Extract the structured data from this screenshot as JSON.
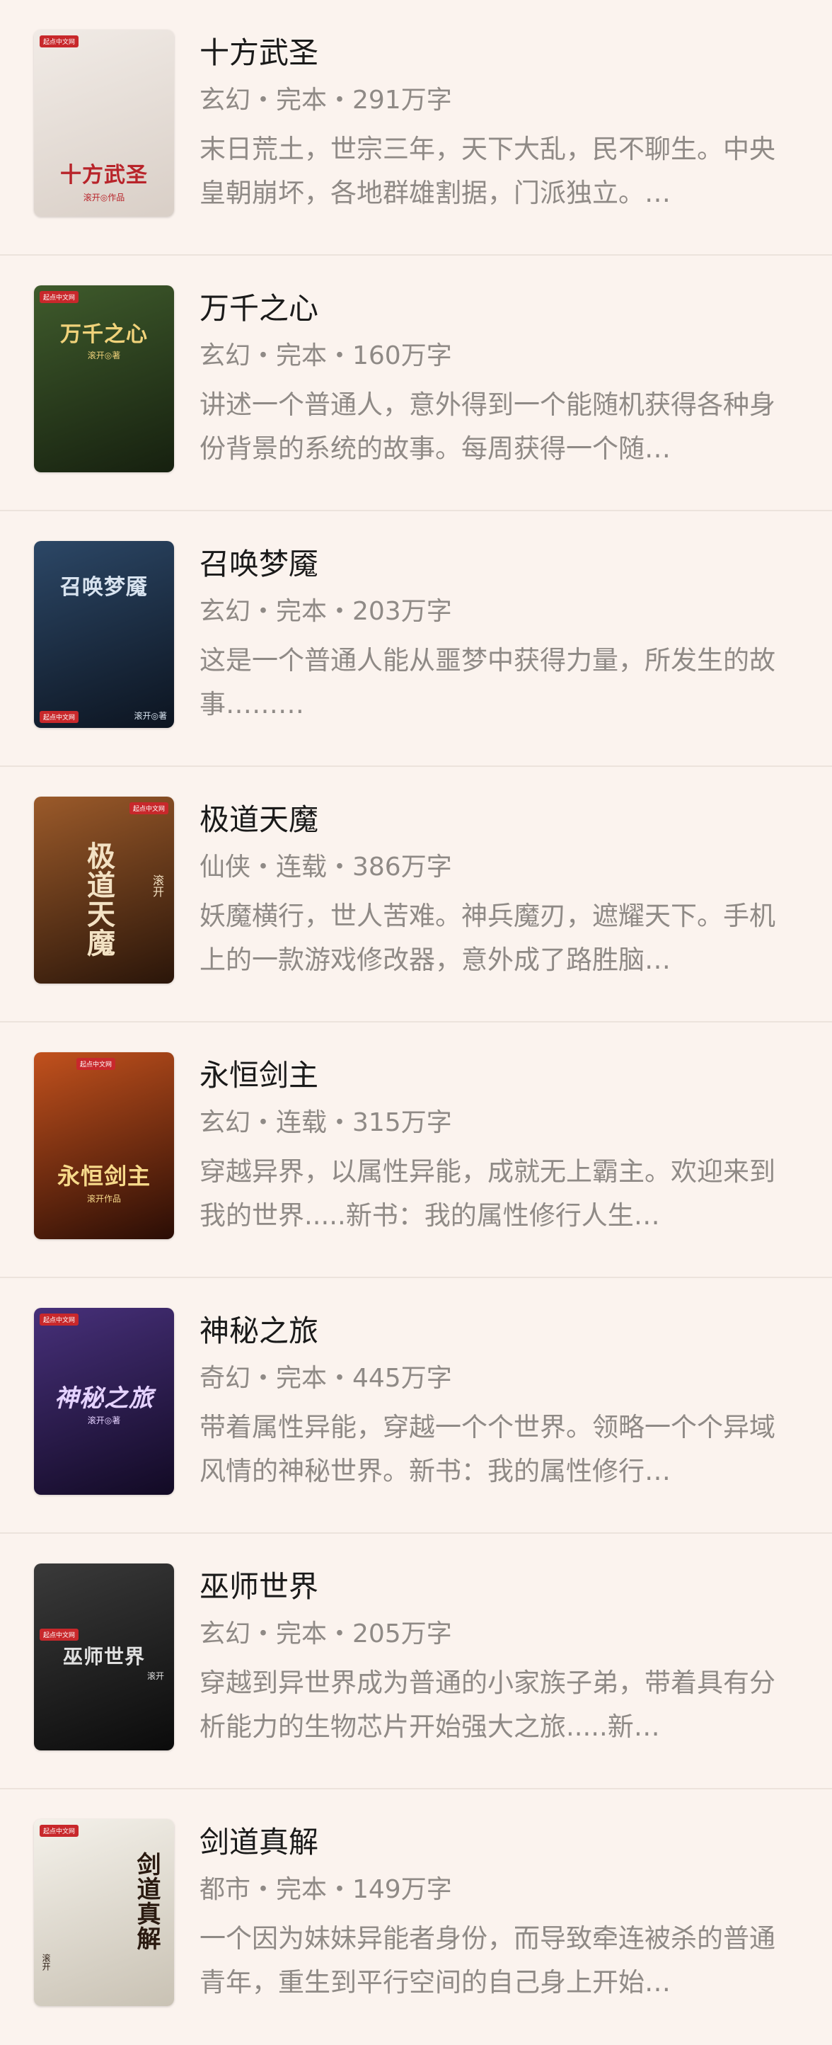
{
  "books": [
    {
      "title": "十方武圣",
      "meta": "玄幻・完本・291万字",
      "desc": "末日荒土，世宗三年，天下大乱，民不聊生。中央皇朝崩坏，各地群雄割据，门派独立。…",
      "cover": {
        "title": "十方武圣",
        "author": "滚开◎作品",
        "badge": "起点中文网",
        "bg1": "#f1ebe6",
        "bg2": "#d9cfc7",
        "fg": "#b8242a"
      }
    },
    {
      "title": "万千之心",
      "meta": "玄幻・完本・160万字",
      "desc": "讲述一个普通人，意外得到一个能随机获得各种身份背景的系统的故事。每周获得一个随…",
      "cover": {
        "title": "万千之心",
        "author": "滚开◎著",
        "badge": "起点中文网",
        "bg1": "#3f5b2c",
        "bg2": "#16200f",
        "fg": "#f0d27a"
      }
    },
    {
      "title": "召唤梦魇",
      "meta": "玄幻・完本・203万字",
      "desc": "这是一个普通人能从噩梦中获得力量，所发生的故事………",
      "cover": {
        "title": "召唤梦魇",
        "author": "滚开◎著",
        "badge": "起点中文网",
        "bg1": "#2c4766",
        "bg2": "#0c1420",
        "fg": "#d8e3ef"
      }
    },
    {
      "title": "极道天魔",
      "meta": "仙侠・连载・386万字",
      "desc": "妖魔横行，世人苦难。神兵魔刃，遮耀天下。手机上的一款游戏修改器，意外成了路胜脑…",
      "cover": {
        "title": "极道天魔",
        "author": "滚开",
        "badge": "起点中文网",
        "bg1": "#9b5a2a",
        "bg2": "#2a1509",
        "fg": "#f3e2c4"
      }
    },
    {
      "title": "永恒剑主",
      "meta": "玄幻・连载・315万字",
      "desc": "穿越异界，以属性异能，成就无上霸主。欢迎来到我的世界.....新书：我的属性修行人生…",
      "cover": {
        "title": "永恒剑主",
        "author": "滚开作品",
        "badge": "起点中文网",
        "bg1": "#c2511d",
        "bg2": "#2a0d05",
        "fg": "#f6d98a"
      }
    },
    {
      "title": "神秘之旅",
      "meta": "奇幻・完本・445万字",
      "desc": "带着属性异能，穿越一个个世界。领略一个个异域风情的神秘世界。新书：我的属性修行…",
      "cover": {
        "title": "神秘之旅",
        "author": "滚开◎著",
        "badge": "起点中文网",
        "bg1": "#47307a",
        "bg2": "#120a24",
        "fg": "#e5d2ff"
      }
    },
    {
      "title": "巫师世界",
      "meta": "玄幻・完本・205万字",
      "desc": "穿越到异世界成为普通的小家族子弟，带着具有分析能力的生物芯片开始强大之旅.....新…",
      "cover": {
        "title": "巫师世界",
        "author": "滚开",
        "badge": "起点中文网",
        "bg1": "#3a3a3a",
        "bg2": "#0b0b0b",
        "fg": "#e0e0e0"
      }
    },
    {
      "title": "剑道真解",
      "meta": "都市・完本・149万字",
      "desc": "一个因为妹妹异能者身份，而导致牵连被杀的普通青年，重生到平行空间的自己身上开始…",
      "cover": {
        "title": "剑道真解",
        "author": "滚开",
        "badge": "起点中文网",
        "bg1": "#f4f1ea",
        "bg2": "#c9c2b4",
        "fg": "#2a1a10"
      }
    }
  ]
}
